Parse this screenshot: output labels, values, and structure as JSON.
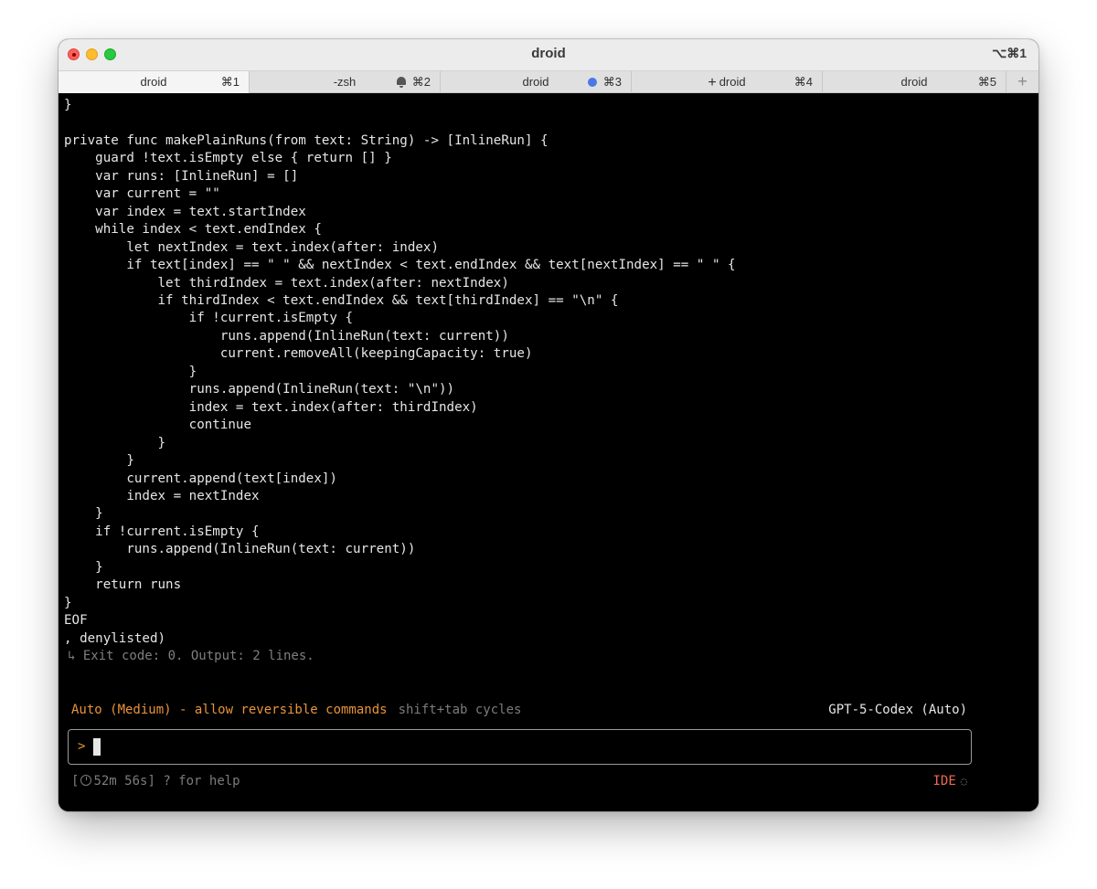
{
  "window": {
    "title": "droid",
    "shortcut": "⌥⌘1"
  },
  "tabs": [
    {
      "label": "droid",
      "key": "⌘1",
      "active": true
    },
    {
      "label": "-zsh",
      "key": "⌘2",
      "icon": "bell-icon"
    },
    {
      "label": "droid",
      "key": "⌘3",
      "icon": "activity-dot-icon"
    },
    {
      "label": "droid",
      "key": "⌘4",
      "icon": "plus-icon"
    },
    {
      "label": "droid",
      "key": "⌘5"
    }
  ],
  "new_tab_label": "+",
  "terminal": {
    "code": "}\n\nprivate func makePlainRuns(from text: String) -> [InlineRun] {\n    guard !text.isEmpty else { return [] }\n    var runs: [InlineRun] = []\n    var current = \"\"\n    var index = text.startIndex\n    while index < text.endIndex {\n        let nextIndex = text.index(after: index)\n        if text[index] == \" \" && nextIndex < text.endIndex && text[nextIndex] == \" \" {\n            let thirdIndex = text.index(after: nextIndex)\n            if thirdIndex < text.endIndex && text[thirdIndex] == \"\\n\" {\n                if !current.isEmpty {\n                    runs.append(InlineRun(text: current))\n                    current.removeAll(keepingCapacity: true)\n                }\n                runs.append(InlineRun(text: \"\\n\"))\n                index = text.index(after: thirdIndex)\n                continue\n            }\n        }\n        current.append(text[index])\n        index = nextIndex\n    }\n    if !current.isEmpty {\n        runs.append(InlineRun(text: current))\n    }\n    return runs\n}\nEOF\n, denylisted)",
    "exit_line": "↳ Exit code: 0. Output: 2 lines."
  },
  "status": {
    "mode": "Auto (Medium) - allow reversible commands",
    "mode_hint": "shift+tab cycles",
    "model": "GPT-5-Codex (Auto)",
    "prompt_symbol": ">",
    "elapsed_open": "[",
    "elapsed": "52m 56s]",
    "help": "? for help",
    "ide": "IDE"
  },
  "colors": {
    "accent_orange": "#e8943a",
    "ide_red": "#ef6a4f",
    "dim_gray": "#7c7c7c",
    "terminal_bg": "#000000"
  }
}
